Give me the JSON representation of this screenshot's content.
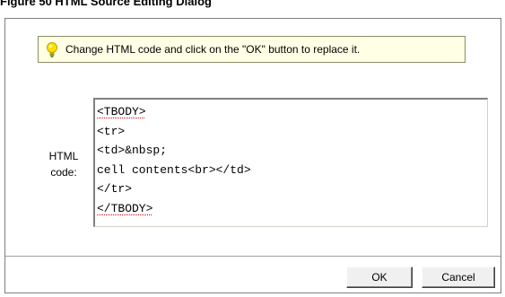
{
  "figure": {
    "caption": "Figure 50 HTML Source Editing Dialog"
  },
  "tip": {
    "icon": "lightbulb-icon",
    "text": "Change HTML code and click on the \"OK\" button to replace it."
  },
  "field": {
    "label_line1": "HTML",
    "label_line2": "code:"
  },
  "code": {
    "lines": [
      "<TBODY>",
      "<tr>",
      "<td>&nbsp;",
      "cell contents<br></td>",
      "</tr>",
      "</TBODY>"
    ]
  },
  "buttons": {
    "ok_label": "OK",
    "cancel_label": "Cancel"
  },
  "colors": {
    "tip_background": "#ffffe6",
    "spellcheck_underline": "#d00000"
  }
}
